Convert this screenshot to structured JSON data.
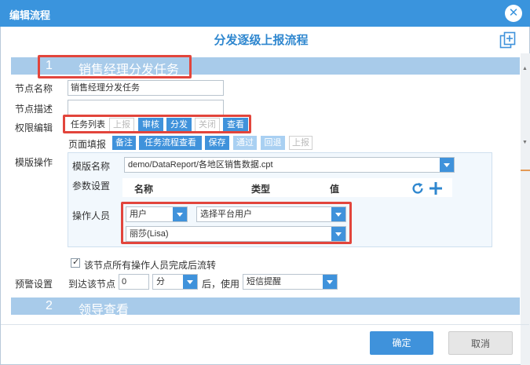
{
  "window": {
    "title": "编辑流程",
    "close_label": "✕"
  },
  "flow_title": "分发逐级上报流程",
  "section1": {
    "number": "1",
    "name": "销售经理分发任务"
  },
  "section2": {
    "number": "2",
    "name": "领导查看"
  },
  "fields": {
    "node_name_label": "节点名称",
    "node_name_value": "销售经理分发任务",
    "node_desc_label": "节点描述",
    "node_desc_value": "",
    "perm_label": "权限编辑",
    "template_ops_label": "模版操作",
    "alert_label": "预警设置"
  },
  "task_list": {
    "label": "任务列表",
    "items": [
      {
        "label": "上报",
        "state": "off"
      },
      {
        "label": "审核",
        "state": "on"
      },
      {
        "label": "分发",
        "state": "on"
      },
      {
        "label": "关闭",
        "state": "off"
      },
      {
        "label": "查看",
        "state": "on"
      }
    ]
  },
  "page_fill": {
    "label": "页面填报",
    "items": [
      {
        "label": "备注",
        "state": "on"
      },
      {
        "label": "任务流程查看",
        "state": "on"
      },
      {
        "label": "保存",
        "state": "on"
      },
      {
        "label": "通过",
        "state": "lite"
      },
      {
        "label": "回退",
        "state": "lite"
      },
      {
        "label": "上报",
        "state": "off"
      }
    ]
  },
  "template": {
    "name_label": "模版名称",
    "name_value": "demo/DataReport/各地区销售数据.cpt",
    "param_label": "参数设置",
    "columns": [
      "名称",
      "类型",
      "值"
    ],
    "operator_label": "操作人员",
    "operator_type": "用户",
    "operator_source": "选择平台用户",
    "operator_user": "丽莎(Lisa)"
  },
  "flow_rule": {
    "text": "该节点所有操作人员完成后流转",
    "checked": true
  },
  "alert": {
    "reach_label": "到达该节点",
    "amount": "0",
    "unit": "分",
    "after_label": "后，使用",
    "method": "短信提醒"
  },
  "buttons": {
    "ok": "确定",
    "cancel": "取消"
  },
  "colors": {
    "accent": "#3f92db",
    "section_bar": "#a8cbea",
    "highlight_box": "#e2453c"
  },
  "icons": [
    "close-icon",
    "copy-icon",
    "refresh-icon",
    "add-icon",
    "checkbox-checked-icon",
    "dropdown-arrow-icon"
  ]
}
